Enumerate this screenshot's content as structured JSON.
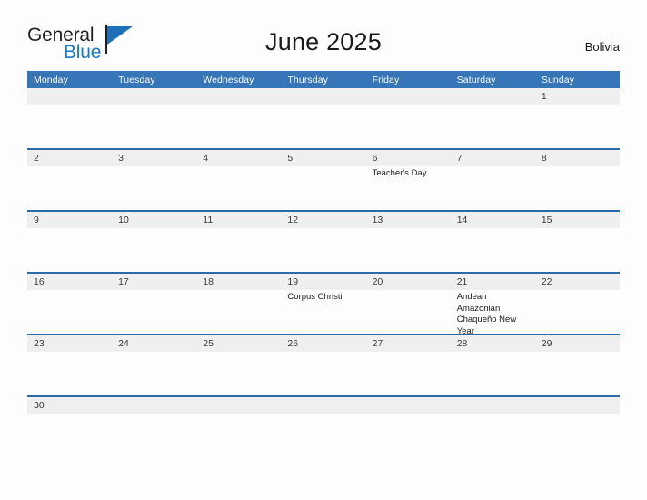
{
  "brand": {
    "name_top": "General",
    "name_bottom": "Blue",
    "flag_icon": "flag-triangle-icon",
    "accent_color": "#1878c8"
  },
  "header": {
    "title": "June 2025",
    "country": "Bolivia"
  },
  "theme": {
    "header_blue": "#3575b8",
    "rule_blue": "#2a6aa8",
    "band_gray": "#efefef",
    "page_background": "#fdfdfd"
  },
  "calendar": {
    "weekdays": [
      "Monday",
      "Tuesday",
      "Wednesday",
      "Thursday",
      "Friday",
      "Saturday",
      "Sunday"
    ],
    "weeks": [
      {
        "days": [
          {
            "num": "",
            "events": []
          },
          {
            "num": "",
            "events": []
          },
          {
            "num": "",
            "events": []
          },
          {
            "num": "",
            "events": []
          },
          {
            "num": "",
            "events": []
          },
          {
            "num": "",
            "events": []
          },
          {
            "num": "1",
            "events": []
          }
        ]
      },
      {
        "days": [
          {
            "num": "2",
            "events": []
          },
          {
            "num": "3",
            "events": []
          },
          {
            "num": "4",
            "events": []
          },
          {
            "num": "5",
            "events": []
          },
          {
            "num": "6",
            "events": [
              "Teacher's Day"
            ]
          },
          {
            "num": "7",
            "events": []
          },
          {
            "num": "8",
            "events": []
          }
        ]
      },
      {
        "days": [
          {
            "num": "9",
            "events": []
          },
          {
            "num": "10",
            "events": []
          },
          {
            "num": "11",
            "events": []
          },
          {
            "num": "12",
            "events": []
          },
          {
            "num": "13",
            "events": []
          },
          {
            "num": "14",
            "events": []
          },
          {
            "num": "15",
            "events": []
          }
        ]
      },
      {
        "days": [
          {
            "num": "16",
            "events": []
          },
          {
            "num": "17",
            "events": []
          },
          {
            "num": "18",
            "events": []
          },
          {
            "num": "19",
            "events": [
              "Corpus Christi"
            ]
          },
          {
            "num": "20",
            "events": []
          },
          {
            "num": "21",
            "events": [
              "Andean Amazonian Chaqueño New Year"
            ]
          },
          {
            "num": "22",
            "events": []
          }
        ]
      },
      {
        "days": [
          {
            "num": "23",
            "events": []
          },
          {
            "num": "24",
            "events": []
          },
          {
            "num": "25",
            "events": []
          },
          {
            "num": "26",
            "events": []
          },
          {
            "num": "27",
            "events": []
          },
          {
            "num": "28",
            "events": []
          },
          {
            "num": "29",
            "events": []
          }
        ]
      },
      {
        "short": true,
        "days": [
          {
            "num": "30",
            "events": []
          },
          {
            "num": "",
            "events": []
          },
          {
            "num": "",
            "events": []
          },
          {
            "num": "",
            "events": []
          },
          {
            "num": "",
            "events": []
          },
          {
            "num": "",
            "events": []
          },
          {
            "num": "",
            "events": []
          }
        ]
      }
    ]
  }
}
